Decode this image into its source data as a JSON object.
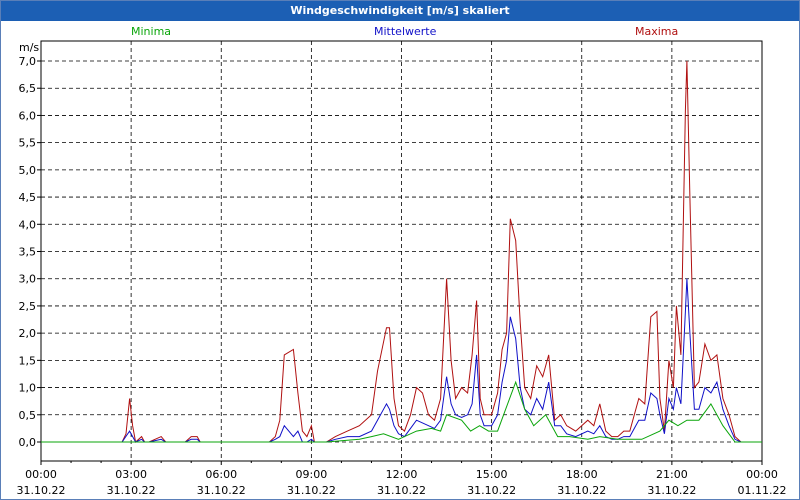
{
  "window": {
    "title": "Windgeschwindigkeit [m/s] skaliert"
  },
  "legend": {
    "minima": "Minima",
    "mean": "Mittelwerte",
    "maxima": "Maxima"
  },
  "colors": {
    "minima": "#0aa50a",
    "mean": "#1010c8",
    "maxima": "#b01010",
    "titlebar": "#1c5fb4"
  },
  "chart_data": {
    "type": "line",
    "ylabel": "m/s",
    "ylim": [
      0,
      7
    ],
    "yticks": [
      "0,0",
      "0,5",
      "1,0",
      "1,5",
      "2,0",
      "2,5",
      "3,0",
      "3,5",
      "4,0",
      "4,5",
      "5,0",
      "5,5",
      "6,0",
      "6,5",
      "7,0"
    ],
    "xlim": [
      0,
      24
    ],
    "xticks": [
      {
        "time": "00:00",
        "date": "31.10.22"
      },
      {
        "time": "03:00",
        "date": "31.10.22"
      },
      {
        "time": "06:00",
        "date": "31.10.22"
      },
      {
        "time": "09:00",
        "date": "31.10.22"
      },
      {
        "time": "12:00",
        "date": "31.10.22"
      },
      {
        "time": "15:00",
        "date": "31.10.22"
      },
      {
        "time": "18:00",
        "date": "31.10.22"
      },
      {
        "time": "21:00",
        "date": "31.10.22"
      },
      {
        "time": "00:00",
        "date": "01.11.22"
      }
    ],
    "grid": true,
    "series": [
      {
        "name": "Maxima",
        "x": [
          0,
          2.7,
          2.83,
          2.95,
          3.05,
          3.15,
          3.35,
          3.45,
          3.6,
          4.0,
          4.15,
          4.3,
          4.8,
          5.0,
          5.2,
          5.3,
          7.6,
          7.8,
          7.95,
          8.1,
          8.4,
          8.55,
          8.7,
          8.85,
          9.0,
          9.1,
          9.3,
          9.5,
          9.8,
          10.2,
          10.6,
          11.0,
          11.2,
          11.5,
          11.6,
          11.75,
          11.9,
          12.1,
          12.3,
          12.5,
          12.7,
          12.9,
          13.1,
          13.3,
          13.5,
          13.65,
          13.8,
          14.0,
          14.2,
          14.35,
          14.5,
          14.62,
          14.75,
          15.0,
          15.2,
          15.35,
          15.5,
          15.62,
          15.8,
          15.95,
          16.1,
          16.3,
          16.5,
          16.7,
          16.9,
          17.1,
          17.3,
          17.5,
          17.8,
          18.2,
          18.4,
          18.6,
          18.8,
          19.0,
          19.2,
          19.4,
          19.6,
          19.9,
          20.1,
          20.3,
          20.5,
          20.6,
          20.75,
          20.9,
          21.05,
          21.15,
          21.3,
          21.45,
          21.5,
          21.6,
          21.75,
          21.9,
          22.1,
          22.3,
          22.5,
          22.7,
          22.9,
          23.1,
          23.3,
          23.5,
          24.0
        ],
        "values": [
          0,
          0,
          0.15,
          0.8,
          0.3,
          0,
          0.1,
          0,
          0,
          0.1,
          0,
          0,
          0,
          0.1,
          0.1,
          0,
          0,
          0.1,
          0.4,
          1.6,
          1.7,
          0.9,
          0.2,
          0.1,
          0.3,
          0,
          0,
          0,
          0.1,
          0.2,
          0.3,
          0.5,
          1.3,
          2.1,
          2.1,
          0.8,
          0.3,
          0.2,
          0.5,
          1.0,
          0.9,
          0.5,
          0.4,
          0.8,
          3.0,
          1.5,
          0.8,
          1.0,
          0.9,
          1.6,
          2.6,
          0.8,
          0.5,
          0.5,
          0.9,
          1.7,
          2.0,
          4.1,
          3.7,
          2.2,
          1.0,
          0.8,
          1.4,
          1.2,
          1.6,
          0.4,
          0.5,
          0.3,
          0.2,
          0.4,
          0.3,
          0.7,
          0.2,
          0.1,
          0.1,
          0.2,
          0.2,
          0.8,
          0.7,
          2.3,
          2.4,
          0.8,
          0.2,
          1.5,
          1.0,
          2.5,
          1.6,
          6.1,
          7.0,
          4.5,
          1.0,
          1.1,
          1.8,
          1.5,
          1.6,
          0.8,
          0.5,
          0.1,
          0,
          0,
          0
        ]
      },
      {
        "name": "Mittelwerte",
        "x": [
          0,
          2.7,
          2.95,
          3.15,
          3.35,
          3.45,
          3.6,
          4.0,
          4.15,
          4.3,
          4.8,
          5.0,
          5.2,
          5.3,
          7.6,
          7.8,
          7.95,
          8.1,
          8.4,
          8.55,
          8.7,
          8.85,
          9.0,
          9.1,
          9.3,
          9.5,
          9.8,
          10.2,
          10.6,
          11.0,
          11.2,
          11.5,
          11.6,
          11.75,
          11.9,
          12.1,
          12.3,
          12.5,
          12.7,
          12.9,
          13.1,
          13.3,
          13.5,
          13.65,
          13.8,
          14.0,
          14.2,
          14.35,
          14.5,
          14.62,
          14.75,
          15.0,
          15.2,
          15.35,
          15.5,
          15.62,
          15.8,
          15.95,
          16.1,
          16.3,
          16.5,
          16.7,
          16.9,
          17.1,
          17.3,
          17.5,
          17.8,
          18.2,
          18.4,
          18.6,
          18.8,
          19.0,
          19.2,
          19.4,
          19.6,
          19.9,
          20.1,
          20.3,
          20.5,
          20.6,
          20.75,
          20.9,
          21.05,
          21.15,
          21.3,
          21.45,
          21.5,
          21.6,
          21.75,
          21.9,
          22.1,
          22.3,
          22.5,
          22.7,
          22.9,
          23.1,
          23.3,
          23.5,
          24.0
        ],
        "values": [
          0,
          0,
          0.2,
          0,
          0.05,
          0,
          0,
          0.05,
          0,
          0,
          0,
          0.05,
          0.05,
          0,
          0,
          0.05,
          0.1,
          0.3,
          0.1,
          0.2,
          0,
          0,
          0.05,
          0,
          0,
          0,
          0.05,
          0.1,
          0.1,
          0.2,
          0.4,
          0.7,
          0.6,
          0.3,
          0.15,
          0.1,
          0.25,
          0.4,
          0.35,
          0.3,
          0.25,
          0.4,
          1.2,
          0.7,
          0.5,
          0.45,
          0.5,
          0.7,
          1.6,
          0.5,
          0.3,
          0.3,
          0.5,
          1.1,
          1.5,
          2.3,
          1.9,
          1.0,
          0.6,
          0.5,
          0.8,
          0.6,
          1.1,
          0.3,
          0.3,
          0.15,
          0.1,
          0.2,
          0.15,
          0.3,
          0.1,
          0.05,
          0.05,
          0.1,
          0.1,
          0.4,
          0.4,
          0.9,
          0.8,
          0.5,
          0.15,
          0.8,
          0.6,
          1.0,
          0.7,
          2.4,
          3.0,
          2.0,
          0.6,
          0.6,
          1.0,
          0.9,
          1.1,
          0.6,
          0.3,
          0.05,
          0,
          0,
          0
        ]
      },
      {
        "name": "Minima",
        "x": [
          0,
          9.5,
          10.6,
          11.0,
          11.4,
          11.9,
          12.1,
          12.5,
          13.0,
          13.3,
          13.5,
          14.0,
          14.3,
          14.6,
          14.9,
          15.2,
          15.4,
          15.8,
          16.1,
          16.4,
          16.8,
          17.2,
          17.6,
          18.2,
          18.6,
          19.2,
          20.0,
          20.6,
          20.9,
          21.2,
          21.5,
          21.9,
          22.3,
          22.7,
          23.1,
          24.0
        ],
        "values": [
          0,
          0,
          0.05,
          0.1,
          0.15,
          0.05,
          0.1,
          0.2,
          0.25,
          0.2,
          0.5,
          0.4,
          0.2,
          0.3,
          0.2,
          0.2,
          0.5,
          1.1,
          0.6,
          0.3,
          0.5,
          0.1,
          0.1,
          0.05,
          0.1,
          0.05,
          0.05,
          0.2,
          0.4,
          0.3,
          0.4,
          0.4,
          0.7,
          0.3,
          0,
          0
        ]
      }
    ]
  }
}
